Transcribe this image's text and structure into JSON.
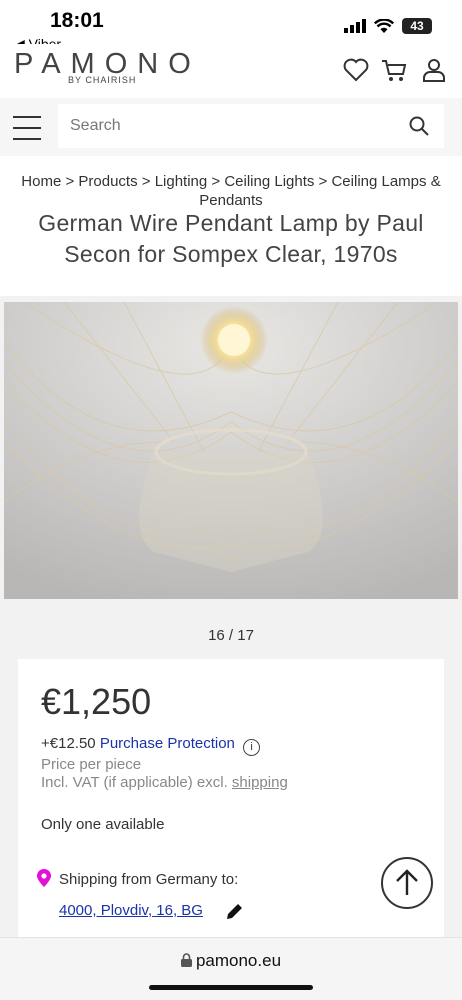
{
  "status": {
    "time": "18:01",
    "back_app": "◀ Viber",
    "battery": "43"
  },
  "header": {
    "logo": "PAMONO",
    "logo_sub": "BY CHAIRISH"
  },
  "search": {
    "placeholder": "Search"
  },
  "breadcrumb": [
    "Home",
    "Products",
    "Lighting",
    "Ceiling Lights",
    "Ceiling Lamps & Pendants"
  ],
  "breadcrumb_text": "Home > Products > Lighting > Ceiling Lights > Ceiling Lamps & Pendants",
  "product": {
    "title": "German Wire Pendant Lamp by Paul Secon for Sompex Clear, 1970s",
    "image_counter": "16 / 17",
    "price": "€1,250",
    "protection_price": "+€12.50",
    "protection_label": "Purchase Protection",
    "price_unit": "Price per piece",
    "vat_note": "Incl. VAT (if applicable) excl. ",
    "shipping_link": "shipping",
    "availability": "Only one available",
    "shipping_from": "Shipping from Germany to:",
    "shipping_address": "4000, Plovdiv, 16, BG"
  },
  "browser": {
    "url": "pamono.eu"
  },
  "colors": {
    "link": "#1b33a8",
    "pin": "#e60fd6"
  }
}
